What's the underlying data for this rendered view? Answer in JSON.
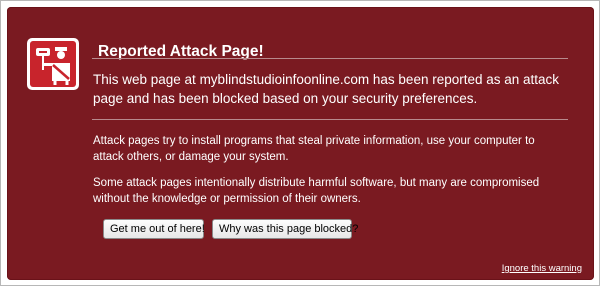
{
  "error_page": {
    "title": "Reported Attack Page!",
    "lead": "This web page at myblindstudioinfoonline.com has been reported as an attack page and has been blocked based on your security preferences.",
    "paragraph_1": "Attack pages try to install programs that steal private information, use your computer to attack others, or damage your system.",
    "paragraph_2": "Some attack pages intentionally distribute harmful software, but many are compromised without the knowledge or permission of their owners.",
    "buttons": {
      "get_out": "Get me out of here!",
      "why_blocked": "Why was this page blocked?"
    },
    "ignore_link": "Ignore this warning"
  },
  "icon": {
    "name": "police-officer-stop-icon"
  },
  "colors": {
    "panel_background": "#7a1a21",
    "icon_background": "#c8242c",
    "text": "#ffffff"
  }
}
